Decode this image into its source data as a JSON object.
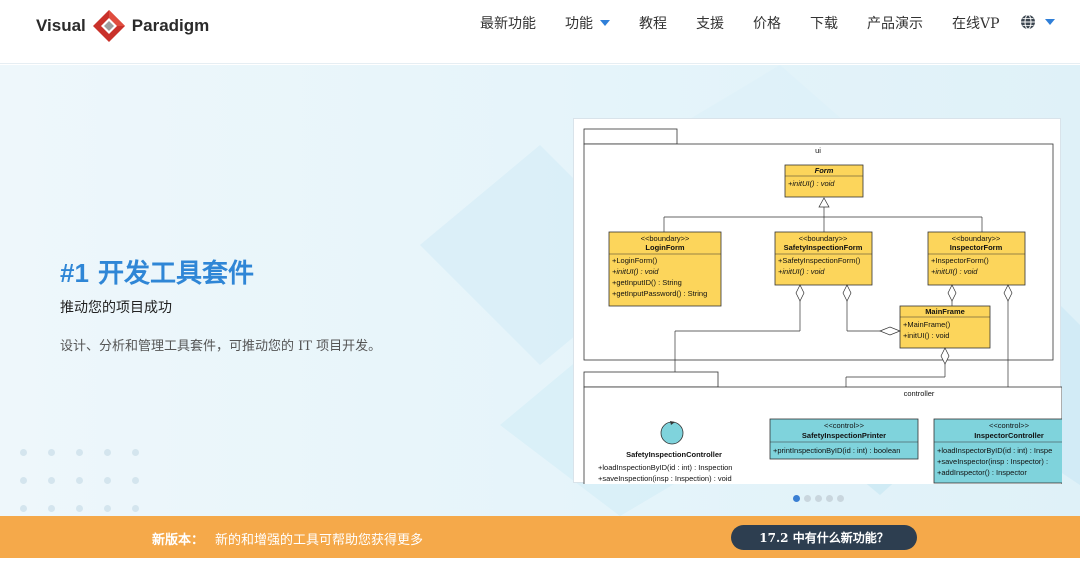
{
  "header": {
    "logo": {
      "left_text": "Visual",
      "right_text": "Paradigm"
    },
    "nav": [
      {
        "label": "最新功能",
        "has_dropdown": false
      },
      {
        "label": "功能",
        "has_dropdown": true
      },
      {
        "label": "教程",
        "has_dropdown": false
      },
      {
        "label": "支援",
        "has_dropdown": false
      },
      {
        "label": "价格",
        "has_dropdown": false
      },
      {
        "label": "下载",
        "has_dropdown": false
      },
      {
        "label": "产品演示",
        "has_dropdown": false
      },
      {
        "label": "在线VP",
        "has_dropdown": false
      }
    ],
    "language_icon": "globe-icon"
  },
  "hero": {
    "title_prefix": "#1",
    "title": "开发工具套件",
    "subtitle": "推动您的项目成功",
    "description": "设计、分析和管理工具套件，可推动您的 IT 项目开发。",
    "carousel": {
      "count": 5,
      "active_index": 0
    }
  },
  "diagram": {
    "ui_package": "ui",
    "controller_package": "controller",
    "form": {
      "name": "Form",
      "ops": [
        "+initUI() : void"
      ]
    },
    "login_form": {
      "stereotype": "<<boundary>>",
      "name": "LoginForm",
      "ops": [
        "+LoginForm()",
        "+initUI() : void",
        "+getInputID() : String",
        "+getInputPassword() : String"
      ]
    },
    "safety_form": {
      "stereotype": "<<boundary>>",
      "name": "SafetyInspectionForm",
      "ops": [
        "+SafetyInspectionForm()",
        "+initUI() : void"
      ]
    },
    "inspector_form": {
      "stereotype": "<<boundary>>",
      "name": "InspectorForm",
      "ops": [
        "+InspectorForm()",
        "+initUI() : void"
      ]
    },
    "main_frame": {
      "name": "MainFrame",
      "ops": [
        "+MainFrame()",
        "+initUI() : void"
      ]
    },
    "safety_controller": {
      "name": "SafetyInspectionController",
      "ops": [
        "+loadInspectionByID(id : int) : Inspection",
        "+saveInspection(insp : Inspection) : void"
      ]
    },
    "safety_printer": {
      "stereotype": "<<control>>",
      "name": "SafetyInspectionPrinter",
      "ops": [
        "+printInspectionByID(id : int) : boolean"
      ]
    },
    "inspector_controller": {
      "stereotype": "<<control>>",
      "name": "InspectorController",
      "ops": [
        "+loadInspectorByID(id : int) : Inspe",
        "+saveInspector(insp : Inspector) : ",
        "+addInspector() : Inspector"
      ]
    }
  },
  "banner": {
    "label": "新版本：",
    "text": "新的和增强的工具可帮助您获得更多",
    "button": "17.2 中有什么新功能？"
  },
  "colors": {
    "accent": "#2f86d6",
    "banner": "#f5a94a",
    "button_bg": "#2d3e50",
    "uml_boundary": "#fcd55b",
    "uml_control": "#7fd3dc"
  }
}
